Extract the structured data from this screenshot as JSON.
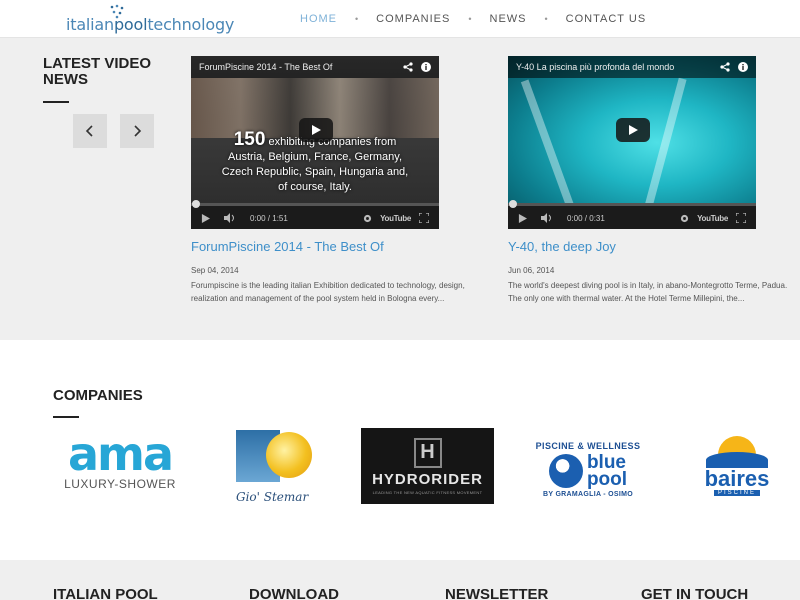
{
  "header": {
    "logo_part1": "italian",
    "logo_part2": "pool",
    "logo_part3": "technology",
    "nav": [
      "HOME",
      "COMPANIES",
      "NEWS",
      "CONTACT US"
    ],
    "nav_active_index": 0,
    "nav_separator": "•"
  },
  "videos_section": {
    "title": "LATEST VIDEO NEWS",
    "prev_icon": "chevron-left-icon",
    "next_icon": "chevron-right-icon",
    "videos": [
      {
        "player_title": "ForumPiscine 2014 - The Best Of",
        "overlay_big": "150",
        "overlay_lines": [
          "exhibiting companies from",
          "Austria, Belgium, France, Germany,",
          "Czech Republic, Spain, Hungaria and,",
          "of course, Italy."
        ],
        "time": "0:00 / 1:51",
        "link": "ForumPiscine 2014 - The Best Of",
        "date": "Sep 04, 2014",
        "description": "Forumpiscine is the leading italian Exhibition dedicated to technology, design, realization and management of the pool system held in Bologna every..."
      },
      {
        "player_title": "Y-40 La piscina più profonda del mondo",
        "time": "0:00 / 0:31",
        "link": "Y-40, the deep Joy",
        "date": "Jun 06, 2014",
        "description": "The world's deepest diving pool is in Italy, in abano-Montegrotto Terme, Padua. The only one with thermal water. At the Hotel Terme Millepini, the..."
      }
    ],
    "youtube_label": "YouTube"
  },
  "companies": {
    "title": "COMPANIES",
    "logos": {
      "ama_word": "ama",
      "ama_sub": "LUXURY-SHOWER",
      "gio_text": "Gio' Stemar",
      "hydro_letter": "H",
      "hydro_name": "HYDRORIDER",
      "hydro_tag": "LEADING THE NEW AQUATIC FITNESS MOVEMENT",
      "blue_top": "PISCINE & WELLNESS",
      "blue_word1": "blue",
      "blue_word2": "pool",
      "blue_bottom": "BY GRAMAGLIA - OSIMO",
      "baires_word": "baires",
      "baires_sub": "PISCINE"
    }
  },
  "footer": {
    "columns": [
      "ITALIAN POOL",
      "DOWNLOAD",
      "NEWSLETTER",
      "GET IN TOUCH"
    ]
  },
  "colors": {
    "accent": "#3e8fc9",
    "nav_active": "#7fb2d8",
    "section_bg": "#efefef"
  }
}
